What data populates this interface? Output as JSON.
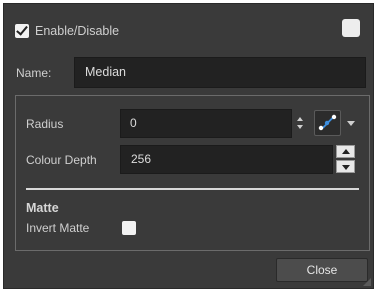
{
  "enable": {
    "label": "Enable/Disable",
    "checked": true
  },
  "name": {
    "label": "Name:",
    "value": "Median"
  },
  "radius": {
    "label": "Radius",
    "value": "0"
  },
  "colour_depth": {
    "label": "Colour Depth",
    "value": "256"
  },
  "matte": {
    "heading": "Matte",
    "invert_label": "Invert Matte",
    "invert_checked": false
  },
  "buttons": {
    "close": "Close"
  },
  "colors": {
    "background": "#3a3a3a",
    "field": "#222222",
    "accent": "#3d8fe0",
    "text": "#d6d6d6"
  }
}
